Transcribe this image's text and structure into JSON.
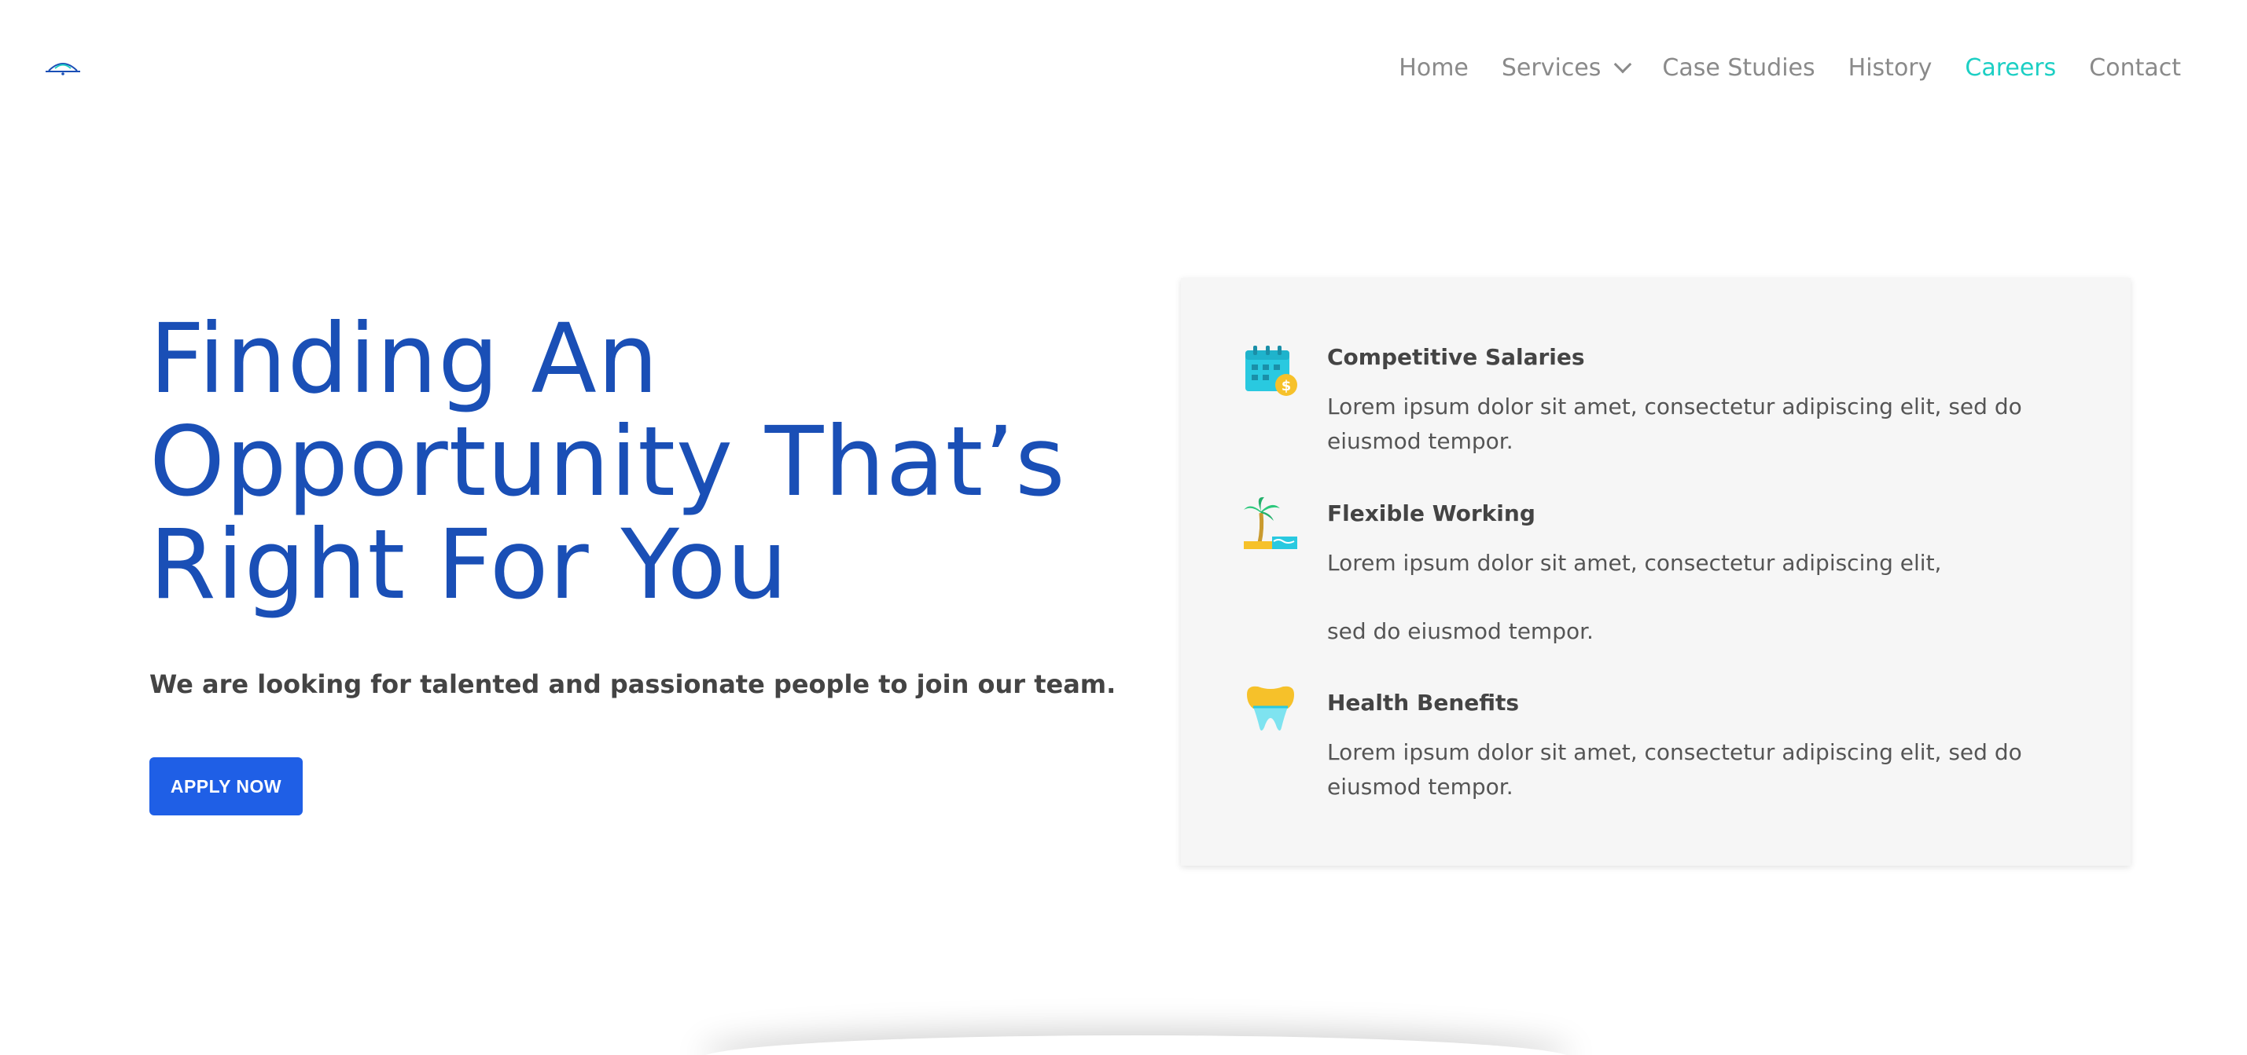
{
  "nav": {
    "items": [
      {
        "label": "Home"
      },
      {
        "label": "Services"
      },
      {
        "label": "Case Studies"
      },
      {
        "label": "History"
      },
      {
        "label": "Careers"
      },
      {
        "label": "Contact"
      }
    ]
  },
  "hero": {
    "title_lines": [
      "Finding An",
      "Opportunity That’s",
      "Right For You"
    ],
    "subtitle": "We are looking for talented and passionate people to join our team.",
    "cta_label": "APPLY NOW"
  },
  "benefits": [
    {
      "title": "Competitive Salaries",
      "desc": "Lorem ipsum dolor sit amet, consectetur adipiscing elit, sed do eiusmod tempor.",
      "icon": "calendar-dollar-icon"
    },
    {
      "title": "Flexible Working",
      "desc": "Lorem ipsum dolor sit amet, consectetur adipiscing elit,",
      "desc2": "sed do eiusmod tempor.",
      "icon": "palm-tree-icon"
    },
    {
      "title": "Health Benefits",
      "desc": "Lorem ipsum dolor sit amet, consectetur adipiscing elit, sed do eiusmod tempor.",
      "icon": "tooth-icon"
    }
  ],
  "colors": {
    "accent": "#1ccfc4",
    "brand": "#1a4fb6",
    "button": "#1f5fe6",
    "nav_text": "#8a8a8a"
  }
}
